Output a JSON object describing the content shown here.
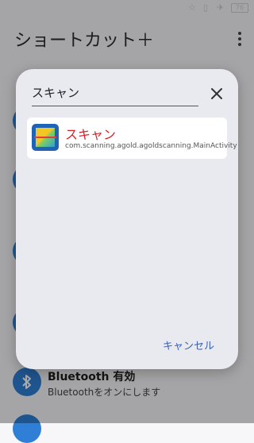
{
  "status_bar": {
    "battery_level": "76",
    "icons": [
      "dnd-icon",
      "vibrate-icon",
      "airplane-icon",
      "battery-icon"
    ]
  },
  "app_bar": {
    "title": "ショートカット＋",
    "menu_icon": "more-vert-icon"
  },
  "background_list": {
    "bluetooth_item": {
      "title": "Bluetooth 有効",
      "subtitle": "Bluetoothをオンにします"
    }
  },
  "dialog": {
    "search_value": "スキャン",
    "close_icon": "close-icon",
    "results": [
      {
        "title": "スキャン",
        "subtitle": "com.scanning.agold.agoldscanning.MainActivity",
        "icon": "qr-scanner-icon"
      }
    ],
    "cancel_label": "キャンセル"
  },
  "colors": {
    "accent_blue": "#2f7fd6",
    "result_title": "#d8222a",
    "cancel_text": "#3a5fb5",
    "dialog_bg": "#e9eaf0"
  }
}
